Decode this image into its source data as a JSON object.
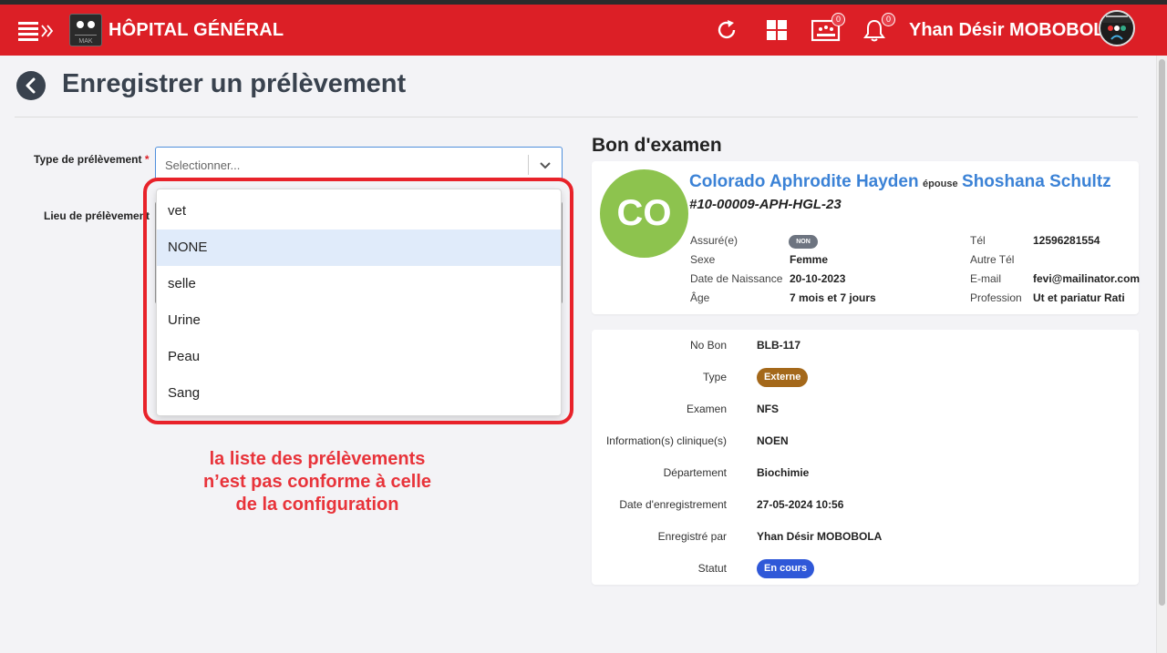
{
  "app": {
    "title": "HÔPITAL GÉNÉRAL",
    "user_name": "Yhan Désir MOBOBOLA",
    "inbox_count": "0",
    "notifications_count": "0",
    "logo_text": "MAK"
  },
  "page": {
    "title": "Enregistrer un prélèvement"
  },
  "form": {
    "type_label": "Type de prélèvement",
    "required_mark": "*",
    "type_placeholder": "Selectionner...",
    "lieu_label": "Lieu de prélèvement",
    "options": [
      "vet",
      "NONE",
      "selle",
      "Urine",
      "Peau",
      "Sang"
    ],
    "highlighted_option": "NONE"
  },
  "annotation": {
    "lines": [
      "la liste des prélèvements",
      "n’est pas conforme à celle",
      "de la configuration"
    ]
  },
  "exam": {
    "section_title": "Bon d'examen",
    "patient": {
      "initials": "CO",
      "name": "Colorado Aphrodite Hayden",
      "spouse_prefix": "épouse",
      "spouse_name": "Shoshana Schultz",
      "id": "#10-00009-APH-HGL-23",
      "assure_label": "Assuré(e)",
      "assure_value": "NON",
      "sexe_label": "Sexe",
      "sexe_value": "Femme",
      "dob_label": "Date de Naissance",
      "dob_value": "20-10-2023",
      "age_label": "Âge",
      "age_value": "7 mois et 7 jours",
      "tel_label": "Tél",
      "tel_value": "12596281554",
      "autre_tel_label": "Autre Tél",
      "autre_tel_value": "",
      "email_label": "E-mail",
      "email_value": "fevi@mailinator.com",
      "profession_label": "Profession",
      "profession_value": "Ut et pariatur Rati"
    },
    "details": {
      "no_bon_label": "No Bon",
      "no_bon_value": "BLB-117",
      "type_label": "Type",
      "type_value": "Externe",
      "examen_label": "Examen",
      "examen_value": "NFS",
      "info_label": "Information(s) clinique(s)",
      "info_value": "NOEN",
      "dept_label": "Département",
      "dept_value": "Biochimie",
      "date_label": "Date d'enregistrement",
      "date_value": "27-05-2024 10:56",
      "by_label": "Enregistré par",
      "by_value": "Yhan Désir MOBOBOLA",
      "statut_label": "Statut",
      "statut_value": "En cours"
    }
  },
  "colors": {
    "topbar": "#dc1f26",
    "accent_blue": "#3b82d6",
    "type_pill": "#a4681a",
    "status_pill": "#2f58d8",
    "avatar_green": "#8dc34e",
    "annotation_red": "#e8333a"
  },
  "icons": {
    "menu": "menu-expand-icon",
    "refresh": "refresh-icon",
    "apps": "apps-grid-icon",
    "inbox": "inbox-icon",
    "bell": "bell-icon",
    "back": "chevron-left-icon",
    "dropdown": "chevron-down-icon"
  }
}
